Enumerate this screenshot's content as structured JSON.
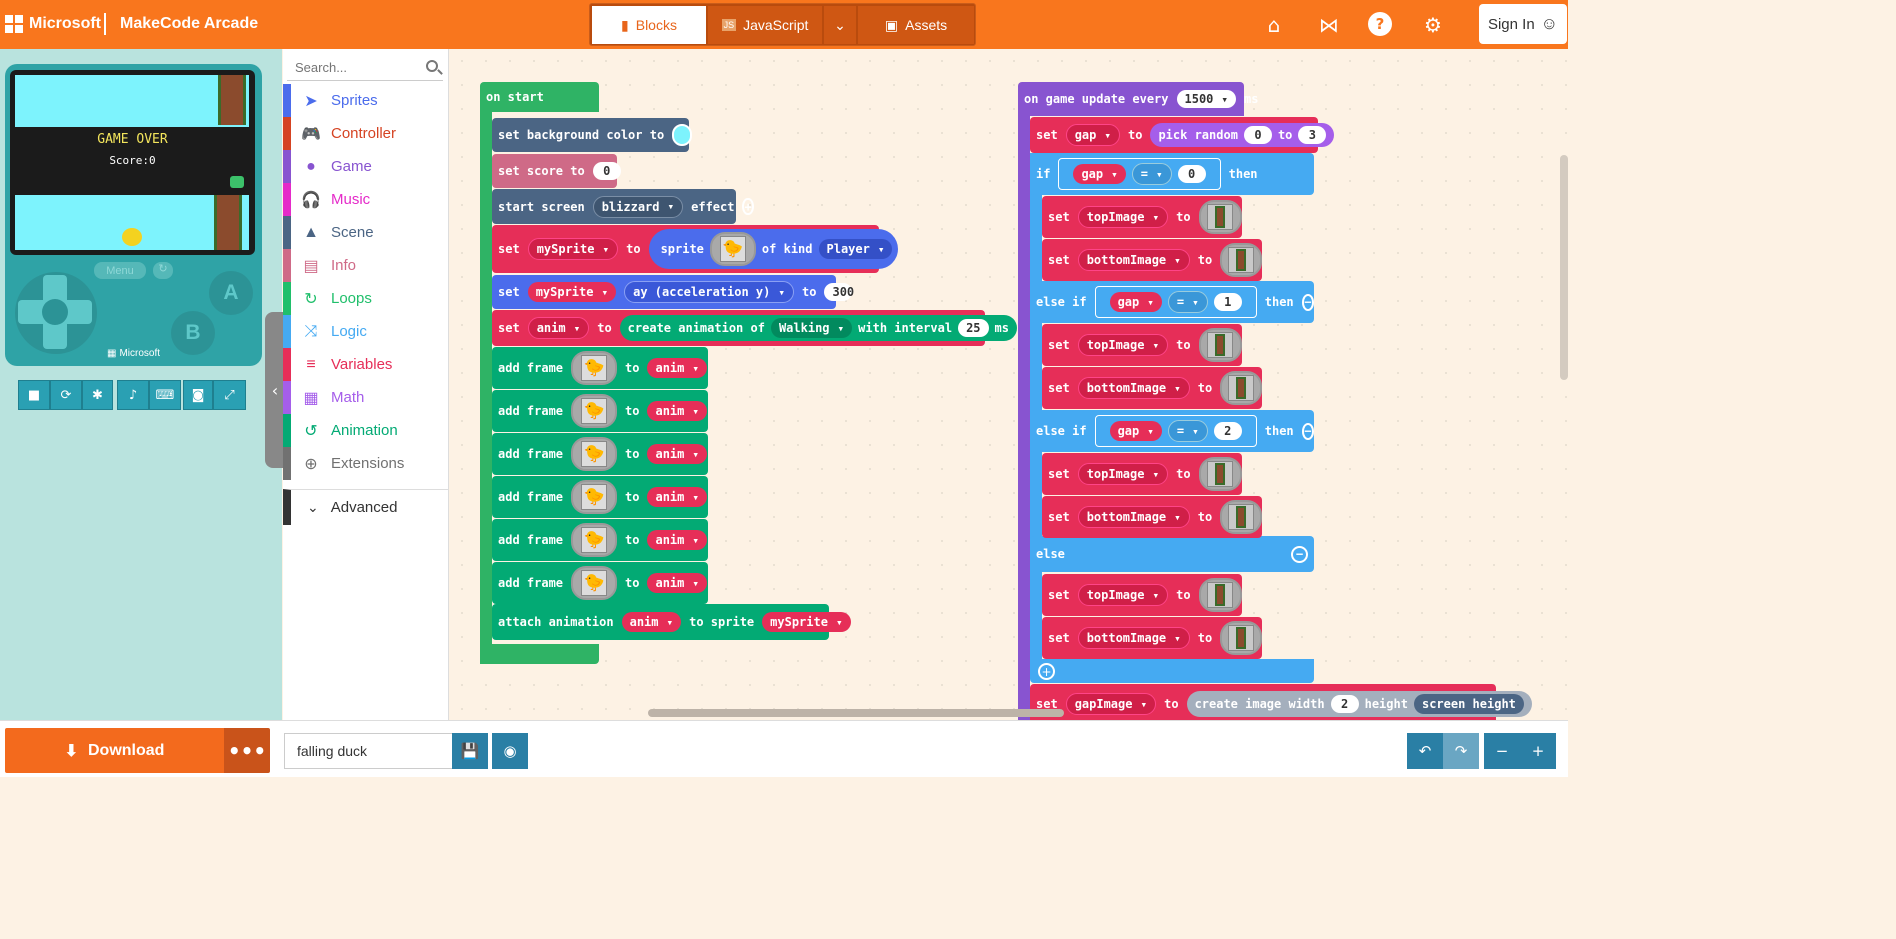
{
  "topbar": {
    "ms_label": "Microsoft",
    "app_name": "MakeCode Arcade",
    "modes": {
      "blocks": "Blocks",
      "javascript": "JavaScript",
      "assets": "Assets"
    },
    "signin": "Sign In"
  },
  "simulator": {
    "game_over": "GAME OVER",
    "score": "Score:0",
    "menu_label": "Menu",
    "brand": "Microsoft",
    "button_a": "A",
    "button_b": "B"
  },
  "toolbox": {
    "search_placeholder": "Search...",
    "categories": [
      {
        "label": "Sprites",
        "color": "#4b6cec"
      },
      {
        "label": "Controller",
        "color": "#d54322"
      },
      {
        "label": "Game",
        "color": "#8854d0"
      },
      {
        "label": "Music",
        "color": "#e52ac9"
      },
      {
        "label": "Scene",
        "color": "#4b6584"
      },
      {
        "label": "Info",
        "color": "#cf6a87"
      },
      {
        "label": "Loops",
        "color": "#20bf6b"
      },
      {
        "label": "Logic",
        "color": "#45aaf2"
      },
      {
        "label": "Variables",
        "color": "#e62e58"
      },
      {
        "label": "Math",
        "color": "#a55eea"
      },
      {
        "label": "Animation",
        "color": "#03aa74"
      },
      {
        "label": "Extensions",
        "color": "#717171"
      }
    ],
    "advanced": "Advanced"
  },
  "blocks": {
    "on_start": "on start",
    "set_bg": "set background color to",
    "set_score": "set score to",
    "score_val": "0",
    "start_screen": "start screen",
    "blizzard": "blizzard",
    "effect": "effect",
    "set": "set",
    "to": "to",
    "mySprite": "mySprite",
    "sprite": "sprite",
    "of_kind": "of kind",
    "player": "Player",
    "ay": "ay (acceleration y)",
    "ay_val": "300",
    "anim": "anim",
    "create_anim": "create animation of",
    "walking": "Walking",
    "with_interval": "with interval",
    "interval_val": "25",
    "ms": "ms",
    "add_frame": "add frame",
    "attach": "attach animation",
    "to_sprite": "to sprite",
    "on_update": "on game update every",
    "update_ms": "1500",
    "gap": "gap",
    "pick_random": "pick random",
    "rand_min": "0",
    "rand_max": "3",
    "if": "if",
    "then": "then",
    "else_if": "else if",
    "else": "else",
    "eq": "=",
    "v0": "0",
    "v1": "1",
    "v2": "2",
    "topImage": "topImage",
    "bottomImage": "bottomImage",
    "gapImage": "gapImage",
    "create_img": "create image width",
    "width_val": "2",
    "height": "height",
    "screen_height": "screen height"
  },
  "bottombar": {
    "download": "Download",
    "more": "•••",
    "project_name": "falling duck"
  }
}
